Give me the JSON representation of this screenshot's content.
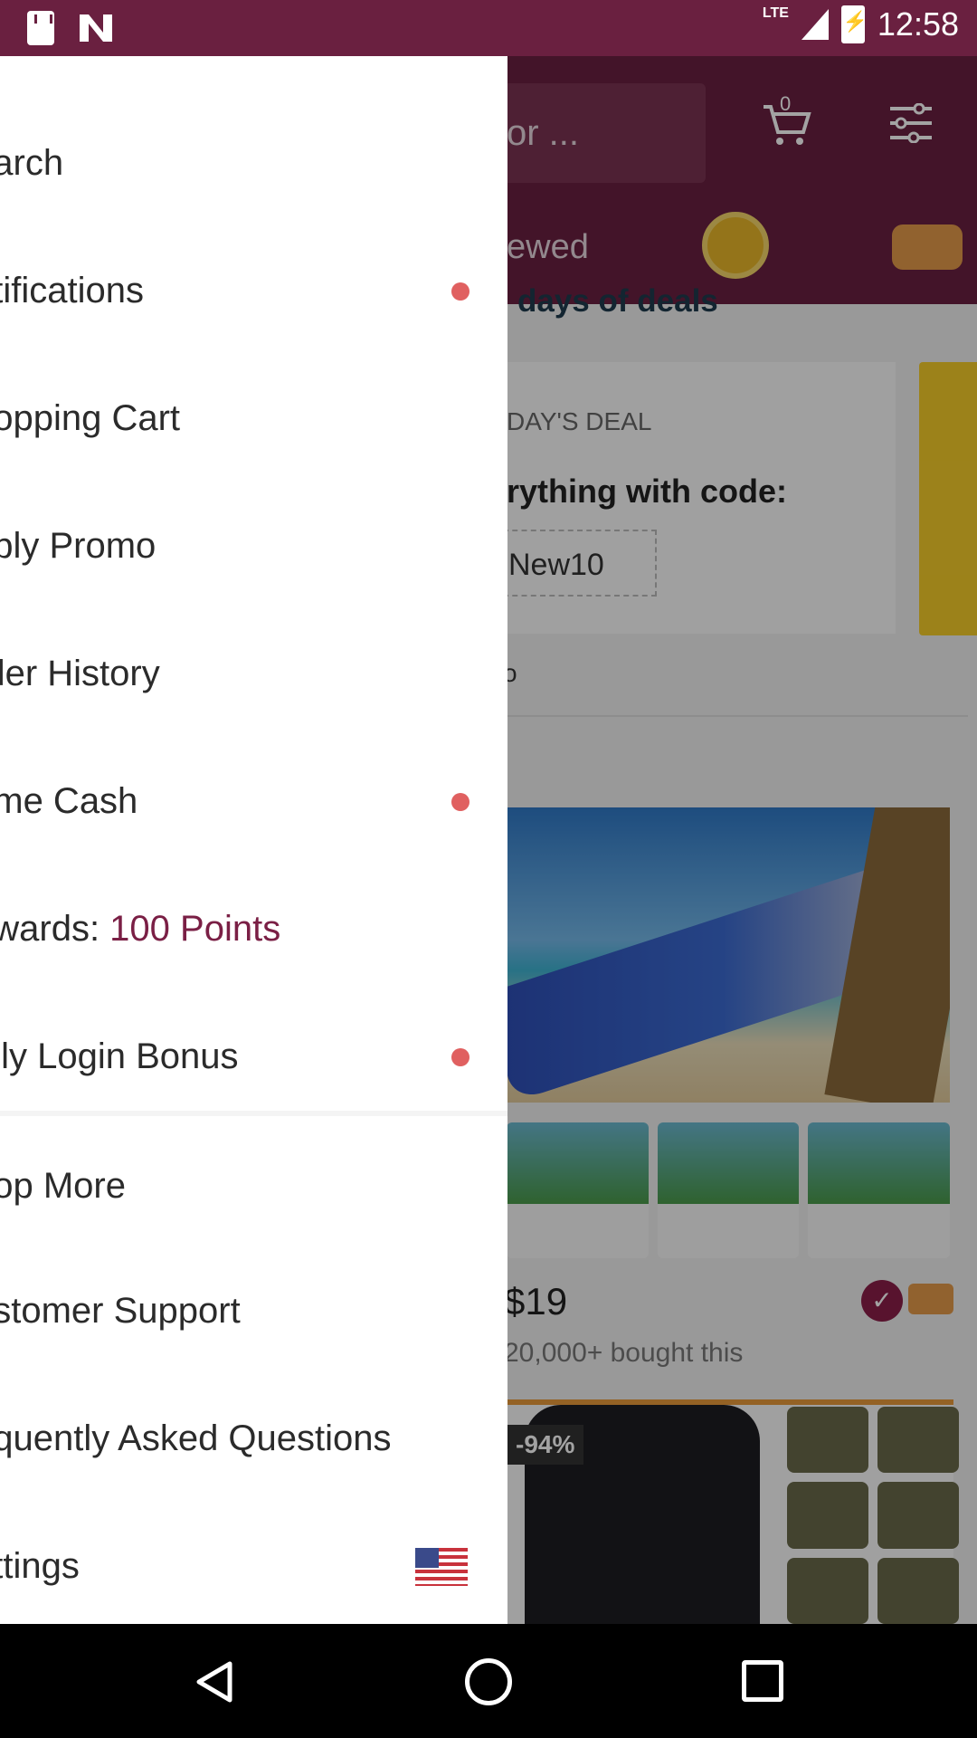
{
  "status_bar": {
    "time": "12:58",
    "network": "LTE"
  },
  "app": {
    "search_placeholder": "or ...",
    "cart_count": "0",
    "tab_viewed": "ewed",
    "section_title": "days of deals",
    "deal_label": "DAY'S DEAL",
    "deal_text": "rything with code:",
    "deal_code": "New10",
    "deal_footer": "o",
    "product_price": "$19",
    "product_bought": "20,000+ bought this",
    "discount_badge": "-94%"
  },
  "drawer": {
    "items": [
      {
        "label": "earch"
      },
      {
        "label": "otifications",
        "badge": true
      },
      {
        "label": "hopping Cart"
      },
      {
        "label": "pply Promo"
      },
      {
        "label": "rder History"
      },
      {
        "label": "ome Cash",
        "badge": true
      },
      {
        "label_prefix": "ewards: ",
        "label_value": "100 Points"
      },
      {
        "label": "aily Login Bonus",
        "badge": true
      },
      {
        "label": "hop More"
      },
      {
        "label": "ustomer Support"
      },
      {
        "label": "equently Asked Questions"
      },
      {
        "label": "ettings",
        "flag": "us-flag-icon"
      }
    ]
  },
  "colors": {
    "brand": "#6a2040",
    "notification_dot": "#e06060",
    "points_highlight": "#7a1f45"
  }
}
